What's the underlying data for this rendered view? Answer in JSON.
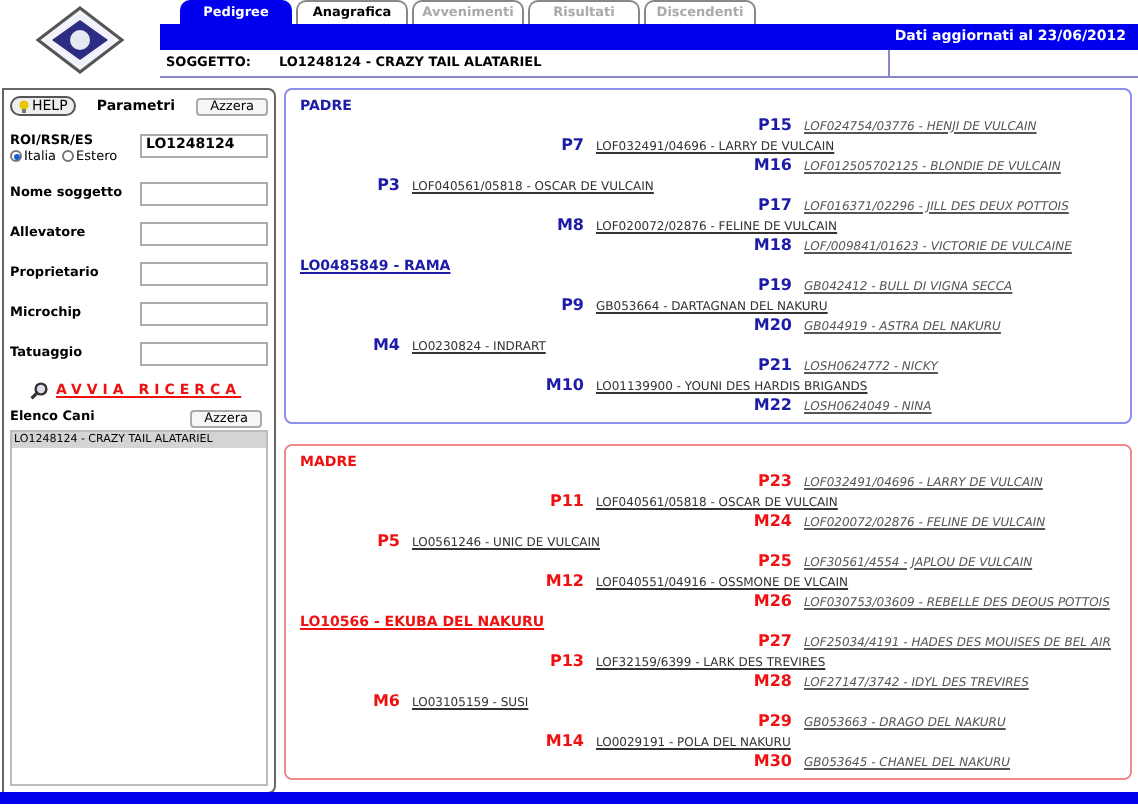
{
  "tabs": [
    {
      "label": "Pedigree",
      "selected": true,
      "disabled": false
    },
    {
      "label": "Anagrafica",
      "selected": false,
      "disabled": false
    },
    {
      "label": "Avvenimenti",
      "selected": false,
      "disabled": true
    },
    {
      "label": "Risultati",
      "selected": false,
      "disabled": true
    },
    {
      "label": "Discendenti",
      "selected": false,
      "disabled": true
    }
  ],
  "header": {
    "updated": "Dati aggiornati al 23/06/2012",
    "subject_label": "SOGGETTO:",
    "subject": "LO1248124 - CRAZY TAIL ALATARIEL"
  },
  "search_panel": {
    "help": "HELP",
    "title": "Parametri",
    "reset": "Azzera",
    "registry": {
      "label": "ROI/RSR/ES",
      "value": "LO1248124",
      "options": [
        {
          "label": "Italia",
          "selected": true
        },
        {
          "label": "Estero",
          "selected": false
        }
      ]
    },
    "fields": [
      {
        "label": "Nome soggetto"
      },
      {
        "label": "Allevatore"
      },
      {
        "label": "Proprietario"
      },
      {
        "label": "Microchip"
      },
      {
        "label": "Tatuaggio"
      }
    ],
    "search": "AVVIA RICERCA",
    "list_title": "Elenco Cani",
    "list_reset": "Azzera",
    "list": [
      {
        "label": "LO1248124 - CRAZY TAIL ALATARIEL",
        "selected": true
      }
    ]
  },
  "sections": [
    {
      "kind": "padre",
      "title": "PADRE",
      "root": {
        "name": "LO0485849 - RAMA",
        "children": [
          {
            "label": "P3",
            "name": "LOF040561/05818 - OSCAR DE VULCAIN",
            "children": [
              {
                "label": "P7",
                "name": "LOF032491/04696 - LARRY DE VULCAIN",
                "children": [
                  {
                    "label": "P15",
                    "name": "LOF024754/03776 - HENJI DE VULCAIN"
                  },
                  {
                    "label": "M16",
                    "name": "LOF012505702125 - BLONDIE DE VULCAIN"
                  }
                ]
              },
              {
                "label": "M8",
                "name": "LOF020072/02876 - FELINE DE VULCAIN",
                "children": [
                  {
                    "label": "P17",
                    "name": "LOF016371/02296 - JILL DES DEUX POTTOIS"
                  },
                  {
                    "label": "M18",
                    "name": "LOF/009841/01623 - VICTORIE DE VULCAINE"
                  }
                ]
              }
            ]
          },
          {
            "label": "M4",
            "name": "LO0230824 - INDRART",
            "children": [
              {
                "label": "P9",
                "name": "GB053664 - DARTAGNAN DEL NAKURU",
                "children": [
                  {
                    "label": "P19",
                    "name": "GB042412 - BULL DI VIGNA SECCA"
                  },
                  {
                    "label": "M20",
                    "name": "GB044919 - ASTRA DEL NAKURU"
                  }
                ]
              },
              {
                "label": "M10",
                "name": "LO01139900 - YOUNI DES HARDIS BRIGANDS",
                "children": [
                  {
                    "label": "P21",
                    "name": "LOSH0624772 - NICKY"
                  },
                  {
                    "label": "M22",
                    "name": "LOSH0624049 - NINA"
                  }
                ]
              }
            ]
          }
        ]
      }
    },
    {
      "kind": "madre",
      "title": "MADRE",
      "root": {
        "name": "LO10566 - EKUBA DEL NAKURU",
        "children": [
          {
            "label": "P5",
            "name": "LO0561246 - UNIC DE VULCAIN",
            "children": [
              {
                "label": "P11",
                "name": "LOF040561/05818 - OSCAR DE VULCAIN",
                "children": [
                  {
                    "label": "P23",
                    "name": "LOF032491/04696 - LARRY DE VULCAIN"
                  },
                  {
                    "label": "M24",
                    "name": "LOF020072/02876 - FELINE DE VULCAIN"
                  }
                ]
              },
              {
                "label": "M12",
                "name": "LOF040551/04916 - OSSMONE DE VLCAIN",
                "children": [
                  {
                    "label": "P25",
                    "name": "LOF30561/4554 - JAPLOU DE VULCAIN"
                  },
                  {
                    "label": "M26",
                    "name": "LOF030753/03609 - REBELLE DES DEOUS POTTOIS"
                  }
                ]
              }
            ]
          },
          {
            "label": "M6",
            "name": "LO03105159 - SUSI",
            "children": [
              {
                "label": "P13",
                "name": "LOF32159/6399 - LARK DES TREVIRES",
                "children": [
                  {
                    "label": "P27",
                    "name": "LOF25034/4191 - HADES DES MOUISES DE BEL AIR"
                  },
                  {
                    "label": "M28",
                    "name": "LOF27147/3742 - IDYL DES TREVIRES"
                  }
                ]
              },
              {
                "label": "M14",
                "name": "LO0029191 - POLA DEL NAKURU",
                "children": [
                  {
                    "label": "P29",
                    "name": "GB053663 - DRAGO DEL NAKURU"
                  },
                  {
                    "label": "M30",
                    "name": "GB053645 - CHANEL DEL NAKURU"
                  }
                ]
              }
            ]
          }
        ]
      }
    }
  ]
}
